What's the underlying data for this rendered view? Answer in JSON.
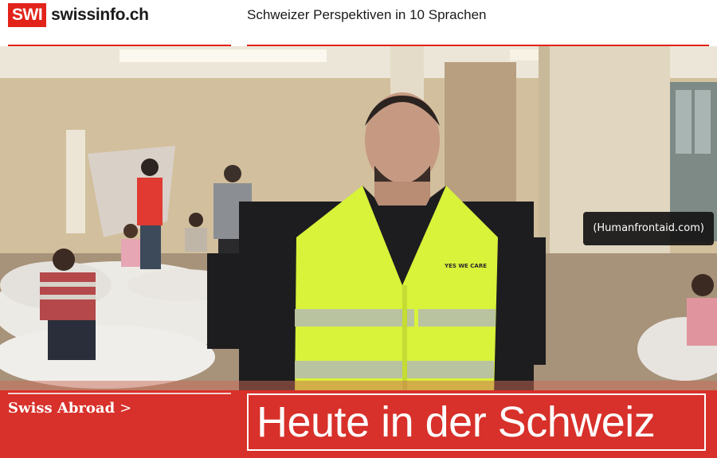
{
  "header": {
    "logo_badge": "SWI",
    "logo_text": "swissinfo.ch",
    "tagline": "Schweizer Perspektiven in 10 Sprachen"
  },
  "photo": {
    "credit": "(Humanfrontaid.com)",
    "vest_text": "YES WE CARE"
  },
  "footer": {
    "section_label": "Swiss Abroad",
    "section_chevron": ">",
    "title": "Heute in der Schweiz"
  },
  "colors": {
    "brand_red": "#e2231a",
    "bar_red": "#d8302a",
    "vest_yellow": "#d9f23a"
  }
}
